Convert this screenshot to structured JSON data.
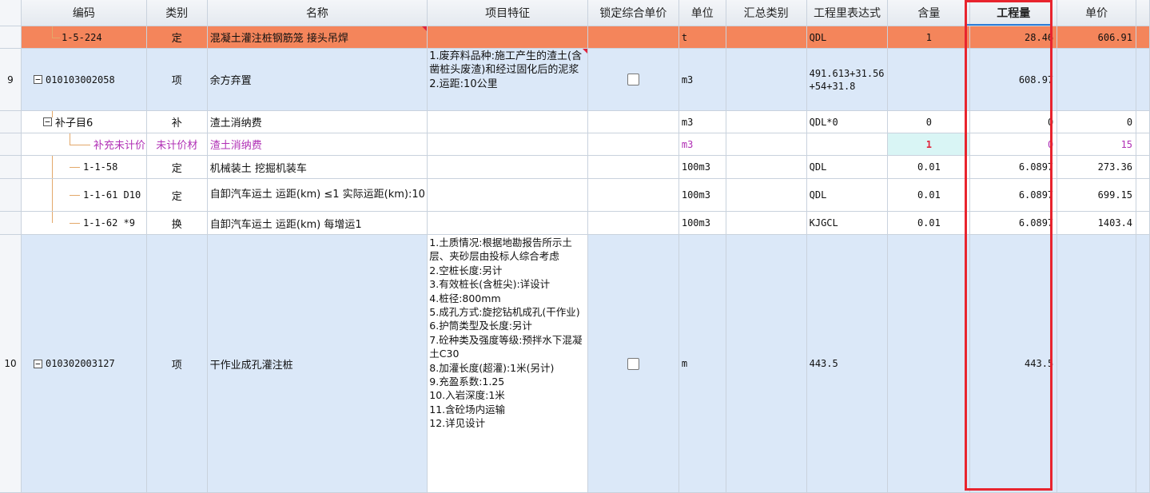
{
  "header": [
    "编码",
    "类别",
    "名称",
    "项目特征",
    "锁定综合单价",
    "单位",
    "汇总类别",
    "工程里表达式",
    "含量",
    "工程量",
    "单价"
  ],
  "rows": [
    {
      "no": "",
      "code": "1-5-224",
      "type": "定",
      "name": "混凝土灌注桩钢筋笼 接头吊焊",
      "feat": "",
      "unit": "t",
      "expr": "QDL",
      "content": "1",
      "qty": "28.46",
      "price": "606.91"
    },
    {
      "no": "9",
      "code": "010103002058",
      "type": "项",
      "name": "余方弃置",
      "feat": "1.废弃料品种:施工产生的渣土(含凿桩头废渣)和经过固化后的泥浆\n2.运距:10公里",
      "unit": "m3",
      "expr": "491.613+31.56+54+31.8",
      "content": "",
      "qty": "608.97",
      "price": ""
    },
    {
      "no": "",
      "code": "补子目6",
      "type": "补",
      "name": "渣土消纳费",
      "feat": "",
      "unit": "m3",
      "expr": "QDL*0",
      "content": "0",
      "qty": "0",
      "price": "0"
    },
    {
      "no": "",
      "code": "补充未计价…",
      "type": "未计价材",
      "name": "渣土消纳费",
      "feat": "",
      "unit": "m3",
      "expr": "",
      "content": "1",
      "qty": "0",
      "price": "15"
    },
    {
      "no": "",
      "code": "1-1-58",
      "type": "定",
      "name": "机械装土 挖掘机装车",
      "feat": "",
      "unit": "100m3",
      "expr": "QDL",
      "content": "0.01",
      "qty": "6.0897",
      "price": "273.36"
    },
    {
      "no": "",
      "code": "1-1-61 D10",
      "type": "定",
      "name": "自卸汽车运土 运距(km) ≤1  实际运距(km):10",
      "feat": "",
      "unit": "100m3",
      "expr": "QDL",
      "content": "0.01",
      "qty": "6.0897",
      "price": "699.15"
    },
    {
      "no": "",
      "code": "1-1-62 *9",
      "type": "换",
      "name": "自卸汽车运土 运距(km) 每增运1",
      "feat": "",
      "unit": "100m3",
      "expr": "KJGCL",
      "content": "0.01",
      "qty": "6.0897",
      "price": "1403.4"
    },
    {
      "no": "10",
      "code": "010302003127",
      "type": "项",
      "name": "干作业成孔灌注桩",
      "feat": "1.土质情况:根据地勘报告所示土层、夹砂层由投标人综合考虑\n2.空桩长度:另计\n3.有效桩长(含桩尖):详设计\n4.桩径:800mm\n5.成孔方式:旋挖钻机成孔(干作业)\n6.护筒类型及长度:另计\n7.砼种类及强度等级:预拌水下混凝土C30\n8.加灌长度(超灌):1米(另计)\n9.充盈系数:1.25\n10.入岩深度:1米\n11.含砼场内运输\n12.详见设计",
      "unit": "m",
      "expr": "443.5",
      "content": "",
      "qty": "443.5",
      "price": ""
    }
  ]
}
